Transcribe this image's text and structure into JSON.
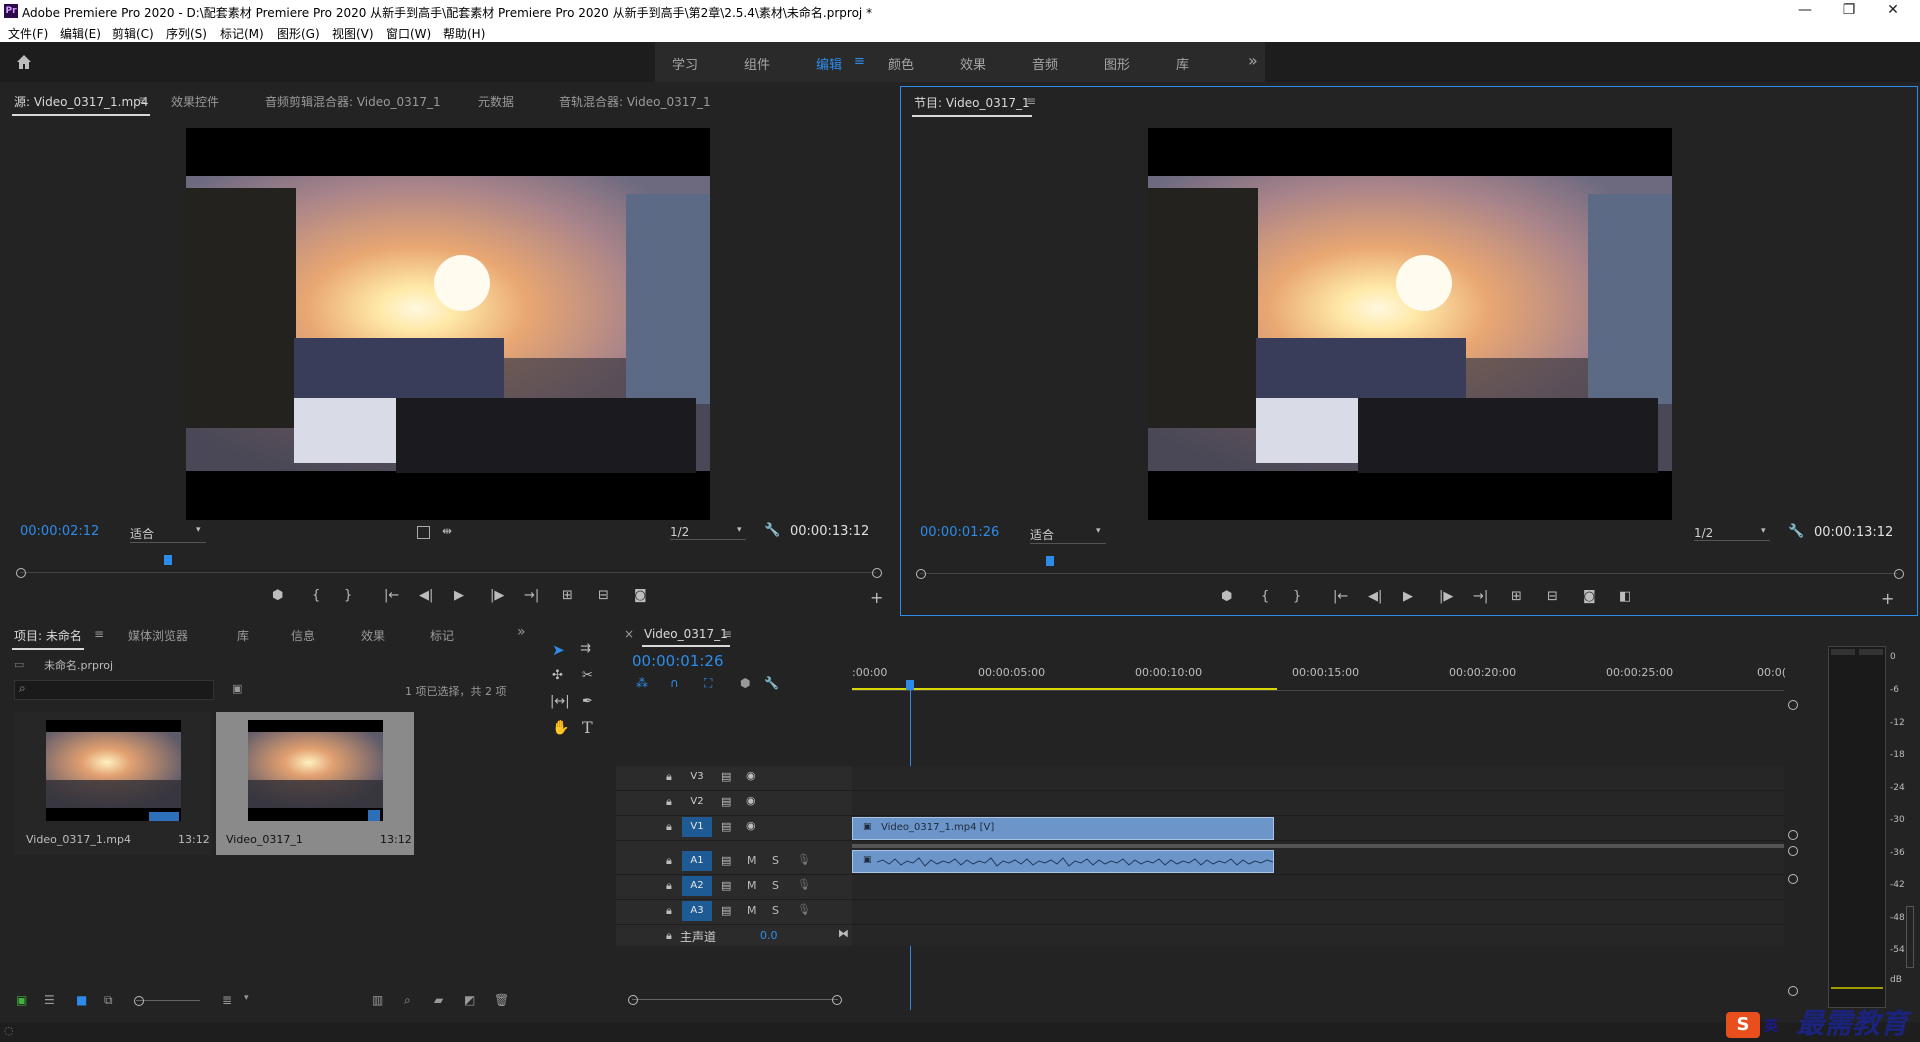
{
  "window": {
    "title": "Adobe Premiere Pro 2020 - D:\\配套素材 Premiere Pro 2020 从新手到高手\\配套素材 Premiere Pro 2020 从新手到高手\\第2章\\2.5.4\\素材\\未命名.prproj *",
    "app_icon": "Pr",
    "minimize": "—",
    "restore": "❐",
    "close": "✕"
  },
  "menubar": [
    "文件(F)",
    "编辑(E)",
    "剪辑(C)",
    "序列(S)",
    "标记(M)",
    "图形(G)",
    "视图(V)",
    "窗口(W)",
    "帮助(H)"
  ],
  "workspaces": {
    "items": [
      "学习",
      "组件",
      "编辑",
      "颜色",
      "效果",
      "音频",
      "图形",
      "库"
    ],
    "active": "编辑",
    "menu_glyph": "≡",
    "overflow": "»"
  },
  "source_monitor": {
    "tabs": [
      "源: Video_0317_1.mp4",
      "效果控件",
      "音频剪辑混合器: Video_0317_1",
      "元数据",
      "音轨混合器: Video_0317_1"
    ],
    "tab_menu": "≡",
    "timecode": "00:00:02:12",
    "fit": "适合",
    "resolution": "1/2",
    "duration": "00:00:13:12"
  },
  "program_monitor": {
    "tab": "节目: Video_0317_1",
    "tab_menu": "≡",
    "timecode": "00:00:01:26",
    "fit": "适合",
    "resolution": "1/2",
    "duration": "00:00:13:12"
  },
  "project_panel": {
    "tabs": [
      "项目: 未命名",
      "媒体浏览器",
      "库",
      "信息",
      "效果",
      "标记"
    ],
    "tab_menu": "≡",
    "overflow": "»",
    "project_file": "未命名.prproj",
    "selection_status": "1 项已选择，共 2 项",
    "items": [
      {
        "name": "Video_0317_1.mp4",
        "duration": "13:12",
        "selected": false
      },
      {
        "name": "Video_0317_1",
        "duration": "13:12",
        "selected": true
      }
    ]
  },
  "timeline": {
    "tab": "Video_0317_1",
    "tab_menu": "≡",
    "close": "×",
    "timecode": "00:00:01:26",
    "ruler_labels": [
      ":00:00",
      "00:00:05:00",
      "00:00:10:00",
      "00:00:15:00",
      "00:00:20:00",
      "00:00:25:00",
      "00:0("
    ],
    "video_tracks": [
      "V3",
      "V2",
      "V1"
    ],
    "audio_tracks": [
      "A1",
      "A2",
      "A3"
    ],
    "master_label": "主声道",
    "master_value": "0.0",
    "track_mute": "M",
    "track_solo": "S",
    "video_clip": "Video_0317_1.mp4 [V]"
  },
  "audio_meter": {
    "scale": [
      "0",
      "-6",
      "-12",
      "-18",
      "-24",
      "-30",
      "-36",
      "-42",
      "-48",
      "-54",
      "dB"
    ]
  },
  "watermark": {
    "text": "最需教育",
    "ime_lang": "英"
  },
  "colors": {
    "accent_blue": "#2d8ceb",
    "clip_video": "#6c95c9",
    "clip_audio": "#6c95c9",
    "track_on": "#1e5a94",
    "work_area": "#d8d800"
  }
}
